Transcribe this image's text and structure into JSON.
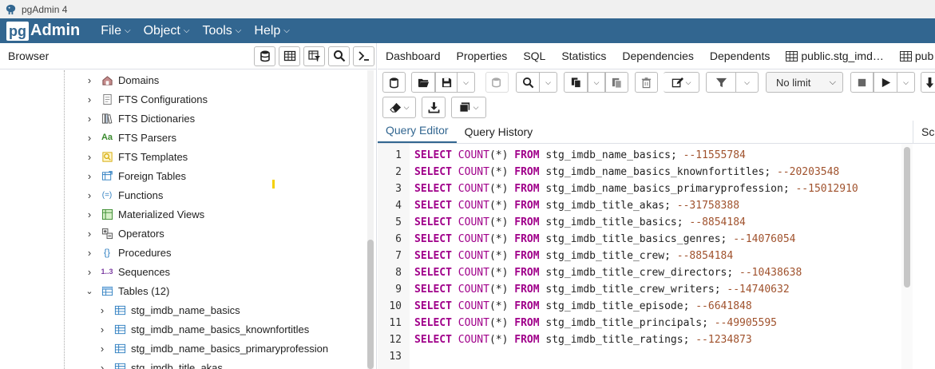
{
  "window": {
    "title": "pgAdmin 4"
  },
  "menubar": {
    "logo_pg": "pg",
    "logo_admin": "Admin",
    "items": [
      {
        "label": "File"
      },
      {
        "label": "Object"
      },
      {
        "label": "Tools"
      },
      {
        "label": "Help"
      }
    ]
  },
  "browser": {
    "title": "Browser",
    "tree": [
      {
        "label": "Domains",
        "icon": "domains-icon"
      },
      {
        "label": "FTS Configurations",
        "icon": "fts-configurations-icon"
      },
      {
        "label": "FTS Dictionaries",
        "icon": "fts-dictionaries-icon"
      },
      {
        "label": "FTS Parsers",
        "icon": "fts-parsers-icon",
        "glyph": "Aa"
      },
      {
        "label": "FTS Templates",
        "icon": "fts-templates-icon"
      },
      {
        "label": "Foreign Tables",
        "icon": "foreign-tables-icon"
      },
      {
        "label": "Functions",
        "icon": "functions-icon",
        "glyph": "(=)"
      },
      {
        "label": "Materialized Views",
        "icon": "materialized-views-icon"
      },
      {
        "label": "Operators",
        "icon": "operators-icon"
      },
      {
        "label": "Procedures",
        "icon": "procedures-icon",
        "glyph": "{}"
      },
      {
        "label": "Sequences",
        "icon": "sequences-icon",
        "glyph": "1..3"
      },
      {
        "label": "Tables (12)",
        "icon": "tables-icon",
        "expanded": true
      },
      {
        "label": "stg_imdb_name_basics",
        "icon": "table-icon"
      },
      {
        "label": "stg_imdb_name_basics_knownfortitles",
        "icon": "table-icon"
      },
      {
        "label": "stg_imdb_name_basics_primaryprofession",
        "icon": "table-icon"
      },
      {
        "label": "stg_imdb_title_akas",
        "icon": "table-icon"
      }
    ]
  },
  "tabs": [
    {
      "label": "Dashboard"
    },
    {
      "label": "Properties"
    },
    {
      "label": "SQL"
    },
    {
      "label": "Statistics"
    },
    {
      "label": "Dependencies"
    },
    {
      "label": "Dependents"
    },
    {
      "label": "public.stg_imd…",
      "icon": "table-icon"
    },
    {
      "label": "pub",
      "icon": "table-icon"
    }
  ],
  "toolbar": {
    "limit_value": "No limit"
  },
  "query_tabs": {
    "editor": "Query Editor",
    "history": "Query History",
    "scratch": "Sc"
  },
  "editor": {
    "lines": [
      {
        "n": "1",
        "table": "stg_imdb_name_basics",
        "comment": "--11555784"
      },
      {
        "n": "2",
        "table": "stg_imdb_name_basics_knownfortitles",
        "comment": "--20203548"
      },
      {
        "n": "3",
        "table": "stg_imdb_name_basics_primaryprofession",
        "comment": "--15012910"
      },
      {
        "n": "4",
        "table": "stg_imdb_title_akas",
        "comment": "--31758388"
      },
      {
        "n": "5",
        "table": "stg_imdb_title_basics",
        "comment": "--8854184"
      },
      {
        "n": "6",
        "table": "stg_imdb_title_basics_genres",
        "comment": "--14076054"
      },
      {
        "n": "7",
        "table": "stg_imdb_title_crew",
        "comment": "--8854184"
      },
      {
        "n": "8",
        "table": "stg_imdb_title_crew_directors",
        "comment": "--10438638"
      },
      {
        "n": "9",
        "table": "stg_imdb_title_crew_writers",
        "comment": "--14740632"
      },
      {
        "n": "10",
        "table": "stg_imdb_title_episode",
        "comment": "--6641848"
      },
      {
        "n": "11",
        "table": "stg_imdb_title_principals",
        "comment": "--49905595"
      },
      {
        "n": "12",
        "table": "stg_imdb_title_ratings",
        "comment": "--1234873"
      },
      {
        "n": "13"
      }
    ],
    "kw_select": "SELECT",
    "kw_count": "COUNT",
    "count_arg": "(*)",
    "kw_from": "FROM"
  }
}
